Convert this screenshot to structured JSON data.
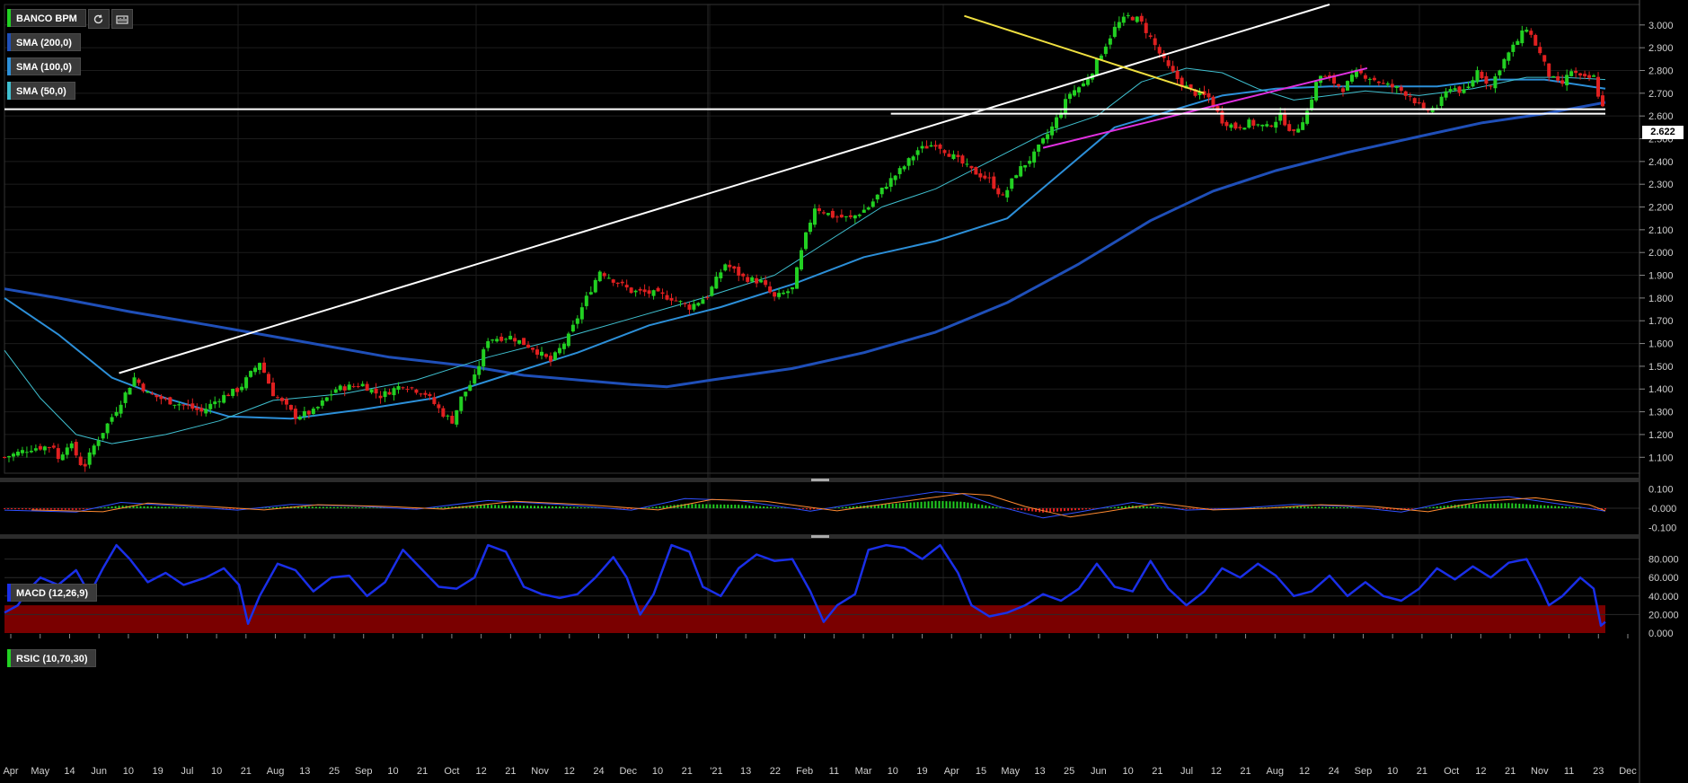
{
  "instrument": "BANCO BPM",
  "colors": {
    "background": "#000000",
    "grid": "#1c1c1c",
    "up_candle": "#22d022",
    "down_candle": "#e02020",
    "sma200": "#1f4fb8",
    "sma100": "#2c8fd8",
    "sma50": "#3fbfcf",
    "trendline_white": "#ffffff",
    "trendline_yellow": "#f0e040",
    "trendline_magenta": "#e030e0",
    "rsi_line": "#1a2fe8",
    "rsi_overbought": "#0c8a0c",
    "rsi_oversold": "#7a0000",
    "macd_line": "#3050ff",
    "signal_line": "#ff8a30"
  },
  "toolbar": {
    "refresh_icon": "refresh-icon",
    "settings_icon": "chart-settings-icon"
  },
  "indicators": [
    {
      "label": "SMA (200,0)",
      "color": "#1f4fb8"
    },
    {
      "label": "SMA (100,0)",
      "color": "#2c8fd8"
    },
    {
      "label": "SMA (50,0)",
      "color": "#3fbfcf"
    }
  ],
  "macd": {
    "label": "MACD (12,26,9)",
    "yticks": [
      "0.100",
      "-0.000",
      "-0.100"
    ]
  },
  "rsi": {
    "label": "RSIC (10,70,30)",
    "yticks": [
      "80.000",
      "60.000",
      "40.000",
      "20.000",
      "0.000"
    ],
    "overbought": 70,
    "oversold": 30
  },
  "chart_data": {
    "type": "candlestick",
    "price_last": "2.622",
    "ylim": [
      1.03,
      3.09
    ],
    "yticks": [
      "3.000",
      "2.900",
      "2.800",
      "2.700",
      "2.600",
      "2.500",
      "2.400",
      "2.300",
      "2.200",
      "2.100",
      "2.000",
      "1.900",
      "1.800",
      "1.700",
      "1.600",
      "1.500",
      "1.400",
      "1.300",
      "1.200",
      "1.100"
    ],
    "xticks": [
      "Apr",
      "May",
      "14",
      "Jun",
      "10",
      "19",
      "Jul",
      "10",
      "21",
      "Aug",
      "13",
      "25",
      "Sep",
      "10",
      "21",
      "Oct",
      "12",
      "21",
      "Nov",
      "12",
      "24",
      "Dec",
      "10",
      "21",
      "'21",
      "13",
      "22",
      "Feb",
      "11",
      "Mar",
      "10",
      "19",
      "Apr",
      "15",
      "May",
      "13",
      "25",
      "Jun",
      "10",
      "21",
      "Jul",
      "12",
      "21",
      "Aug",
      "12",
      "24",
      "Sep",
      "10",
      "21",
      "Oct",
      "12",
      "21",
      "Nov",
      "11",
      "23",
      "Dec"
    ],
    "close_path": [
      [
        0,
        1.1
      ],
      [
        30,
        1.14
      ],
      [
        55,
        1.15
      ],
      [
        60,
        1.09
      ],
      [
        72,
        1.17
      ],
      [
        88,
        1.05
      ],
      [
        100,
        1.15
      ],
      [
        125,
        1.31
      ],
      [
        145,
        1.45
      ],
      [
        160,
        1.38
      ],
      [
        180,
        1.35
      ],
      [
        200,
        1.33
      ],
      [
        220,
        1.3
      ],
      [
        240,
        1.36
      ],
      [
        262,
        1.4
      ],
      [
        285,
        1.52
      ],
      [
        300,
        1.38
      ],
      [
        325,
        1.28
      ],
      [
        345,
        1.3
      ],
      [
        370,
        1.4
      ],
      [
        400,
        1.42
      ],
      [
        420,
        1.37
      ],
      [
        445,
        1.42
      ],
      [
        470,
        1.38
      ],
      [
        490,
        1.29
      ],
      [
        500,
        1.26
      ],
      [
        510,
        1.36
      ],
      [
        525,
        1.45
      ],
      [
        540,
        1.62
      ],
      [
        565,
        1.63
      ],
      [
        590,
        1.58
      ],
      [
        610,
        1.52
      ],
      [
        630,
        1.63
      ],
      [
        650,
        1.8
      ],
      [
        665,
        1.92
      ],
      [
        680,
        1.88
      ],
      [
        700,
        1.83
      ],
      [
        725,
        1.82
      ],
      [
        745,
        1.8
      ],
      [
        765,
        1.76
      ],
      [
        785,
        1.81
      ],
      [
        805,
        1.95
      ],
      [
        825,
        1.89
      ],
      [
        845,
        1.87
      ],
      [
        860,
        1.8
      ],
      [
        880,
        1.84
      ],
      [
        893,
        2.05
      ],
      [
        905,
        2.2
      ],
      [
        925,
        2.16
      ],
      [
        945,
        2.15
      ],
      [
        965,
        2.2
      ],
      [
        985,
        2.3
      ],
      [
        1005,
        2.38
      ],
      [
        1020,
        2.45
      ],
      [
        1040,
        2.48
      ],
      [
        1060,
        2.42
      ],
      [
        1080,
        2.36
      ],
      [
        1100,
        2.32
      ],
      [
        1115,
        2.24
      ],
      [
        1130,
        2.35
      ],
      [
        1150,
        2.43
      ],
      [
        1170,
        2.55
      ],
      [
        1190,
        2.7
      ],
      [
        1205,
        2.74
      ],
      [
        1215,
        2.8
      ],
      [
        1228,
        2.9
      ],
      [
        1242,
        3.0
      ],
      [
        1256,
        3.04
      ],
      [
        1268,
        3.02
      ],
      [
        1282,
        2.93
      ],
      [
        1298,
        2.82
      ],
      [
        1315,
        2.74
      ],
      [
        1330,
        2.7
      ],
      [
        1345,
        2.68
      ],
      [
        1360,
        2.58
      ],
      [
        1375,
        2.55
      ],
      [
        1390,
        2.57
      ],
      [
        1410,
        2.55
      ],
      [
        1425,
        2.6
      ],
      [
        1440,
        2.52
      ],
      [
        1455,
        2.62
      ],
      [
        1468,
        2.78
      ],
      [
        1480,
        2.76
      ],
      [
        1495,
        2.72
      ],
      [
        1510,
        2.79
      ],
      [
        1525,
        2.77
      ],
      [
        1540,
        2.74
      ],
      [
        1556,
        2.72
      ],
      [
        1570,
        2.69
      ],
      [
        1585,
        2.62
      ],
      [
        1600,
        2.64
      ],
      [
        1615,
        2.73
      ],
      [
        1632,
        2.7
      ],
      [
        1645,
        2.8
      ],
      [
        1660,
        2.73
      ],
      [
        1672,
        2.83
      ],
      [
        1688,
        2.92
      ],
      [
        1700,
        2.99
      ],
      [
        1712,
        2.9
      ],
      [
        1725,
        2.78
      ],
      [
        1738,
        2.73
      ],
      [
        1750,
        2.8
      ],
      [
        1762,
        2.76
      ],
      [
        1775,
        2.77
      ],
      [
        1783,
        2.65
      ],
      [
        1788,
        2.62
      ]
    ],
    "series": [
      {
        "name": "SMA (200,0)",
        "values": [
          [
            0,
            1.84
          ],
          [
            60,
            1.8
          ],
          [
            140,
            1.74
          ],
          [
            230,
            1.68
          ],
          [
            330,
            1.61
          ],
          [
            430,
            1.54
          ],
          [
            520,
            1.5
          ],
          [
            580,
            1.46
          ],
          [
            640,
            1.44
          ],
          [
            700,
            1.42
          ],
          [
            740,
            1.41
          ],
          [
            790,
            1.44
          ],
          [
            880,
            1.49
          ],
          [
            960,
            1.56
          ],
          [
            1040,
            1.65
          ],
          [
            1120,
            1.78
          ],
          [
            1200,
            1.95
          ],
          [
            1280,
            2.14
          ],
          [
            1350,
            2.27
          ],
          [
            1420,
            2.36
          ],
          [
            1500,
            2.44
          ],
          [
            1580,
            2.51
          ],
          [
            1650,
            2.57
          ],
          [
            1720,
            2.61
          ],
          [
            1788,
            2.66
          ]
        ]
      },
      {
        "name": "SMA (100,0)",
        "values": [
          [
            0,
            1.8
          ],
          [
            60,
            1.64
          ],
          [
            120,
            1.45
          ],
          [
            180,
            1.36
          ],
          [
            250,
            1.28
          ],
          [
            320,
            1.27
          ],
          [
            400,
            1.31
          ],
          [
            480,
            1.36
          ],
          [
            560,
            1.46
          ],
          [
            640,
            1.56
          ],
          [
            720,
            1.68
          ],
          [
            800,
            1.76
          ],
          [
            880,
            1.86
          ],
          [
            960,
            1.98
          ],
          [
            1040,
            2.05
          ],
          [
            1120,
            2.15
          ],
          [
            1180,
            2.35
          ],
          [
            1240,
            2.55
          ],
          [
            1300,
            2.62
          ],
          [
            1360,
            2.69
          ],
          [
            1420,
            2.72
          ],
          [
            1480,
            2.73
          ],
          [
            1540,
            2.73
          ],
          [
            1600,
            2.73
          ],
          [
            1660,
            2.76
          ],
          [
            1720,
            2.76
          ],
          [
            1788,
            2.72
          ]
        ]
      },
      {
        "name": "SMA (50,0)",
        "values": [
          [
            0,
            1.57
          ],
          [
            40,
            1.36
          ],
          [
            80,
            1.2
          ],
          [
            120,
            1.16
          ],
          [
            180,
            1.2
          ],
          [
            240,
            1.26
          ],
          [
            300,
            1.35
          ],
          [
            380,
            1.38
          ],
          [
            460,
            1.44
          ],
          [
            540,
            1.54
          ],
          [
            620,
            1.62
          ],
          [
            700,
            1.71
          ],
          [
            780,
            1.8
          ],
          [
            860,
            1.9
          ],
          [
            920,
            2.05
          ],
          [
            980,
            2.2
          ],
          [
            1040,
            2.28
          ],
          [
            1100,
            2.4
          ],
          [
            1160,
            2.52
          ],
          [
            1220,
            2.6
          ],
          [
            1270,
            2.75
          ],
          [
            1320,
            2.81
          ],
          [
            1360,
            2.79
          ],
          [
            1400,
            2.72
          ],
          [
            1440,
            2.67
          ],
          [
            1480,
            2.69
          ],
          [
            1520,
            2.71
          ],
          [
            1580,
            2.69
          ],
          [
            1640,
            2.72
          ],
          [
            1700,
            2.77
          ],
          [
            1740,
            2.77
          ],
          [
            1788,
            2.76
          ]
        ]
      }
    ],
    "trendlines": [
      {
        "color": "#ffffff",
        "points": [
          [
            128,
            1.47
          ],
          [
            1480,
            3.09
          ]
        ]
      },
      {
        "color": "#f0e040",
        "points": [
          [
            1072,
            3.04
          ],
          [
            1340,
            2.7
          ]
        ]
      },
      {
        "color": "#e030e0",
        "points": [
          [
            1160,
            2.46
          ],
          [
            1522,
            2.81
          ]
        ]
      },
      {
        "color": "#ffffff",
        "points": [
          [
            0,
            2.63
          ],
          [
            1788,
            2.63
          ]
        ]
      },
      {
        "color": "#ffffff",
        "points": [
          [
            990,
            2.61
          ],
          [
            1788,
            2.61
          ]
        ]
      }
    ],
    "rsi_values": [
      [
        0,
        22
      ],
      [
        15,
        30
      ],
      [
        25,
        45
      ],
      [
        40,
        60
      ],
      [
        60,
        52
      ],
      [
        80,
        68
      ],
      [
        95,
        42
      ],
      [
        110,
        70
      ],
      [
        125,
        95
      ],
      [
        140,
        80
      ],
      [
        160,
        55
      ],
      [
        180,
        65
      ],
      [
        200,
        52
      ],
      [
        225,
        60
      ],
      [
        245,
        70
      ],
      [
        262,
        52
      ],
      [
        272,
        10
      ],
      [
        285,
        40
      ],
      [
        305,
        75
      ],
      [
        325,
        68
      ],
      [
        345,
        45
      ],
      [
        365,
        60
      ],
      [
        385,
        62
      ],
      [
        405,
        40
      ],
      [
        425,
        55
      ],
      [
        445,
        90
      ],
      [
        465,
        70
      ],
      [
        485,
        50
      ],
      [
        505,
        48
      ],
      [
        525,
        60
      ],
      [
        540,
        95
      ],
      [
        560,
        88
      ],
      [
        580,
        50
      ],
      [
        600,
        42
      ],
      [
        620,
        38
      ],
      [
        640,
        42
      ],
      [
        660,
        60
      ],
      [
        680,
        82
      ],
      [
        695,
        60
      ],
      [
        710,
        20
      ],
      [
        725,
        42
      ],
      [
        745,
        95
      ],
      [
        765,
        88
      ],
      [
        780,
        50
      ],
      [
        800,
        40
      ],
      [
        820,
        70
      ],
      [
        840,
        85
      ],
      [
        860,
        78
      ],
      [
        880,
        80
      ],
      [
        900,
        45
      ],
      [
        915,
        12
      ],
      [
        930,
        30
      ],
      [
        950,
        42
      ],
      [
        965,
        90
      ],
      [
        985,
        95
      ],
      [
        1005,
        92
      ],
      [
        1025,
        80
      ],
      [
        1045,
        95
      ],
      [
        1065,
        65
      ],
      [
        1080,
        30
      ],
      [
        1100,
        18
      ],
      [
        1120,
        22
      ],
      [
        1140,
        30
      ],
      [
        1160,
        42
      ],
      [
        1180,
        35
      ],
      [
        1200,
        48
      ],
      [
        1220,
        75
      ],
      [
        1240,
        50
      ],
      [
        1260,
        45
      ],
      [
        1280,
        78
      ],
      [
        1300,
        48
      ],
      [
        1320,
        30
      ],
      [
        1340,
        45
      ],
      [
        1360,
        70
      ],
      [
        1380,
        60
      ],
      [
        1400,
        75
      ],
      [
        1420,
        62
      ],
      [
        1440,
        40
      ],
      [
        1460,
        45
      ],
      [
        1480,
        62
      ],
      [
        1500,
        40
      ],
      [
        1520,
        55
      ],
      [
        1540,
        40
      ],
      [
        1560,
        35
      ],
      [
        1580,
        48
      ],
      [
        1600,
        70
      ],
      [
        1620,
        58
      ],
      [
        1640,
        72
      ],
      [
        1660,
        60
      ],
      [
        1680,
        76
      ],
      [
        1700,
        80
      ],
      [
        1715,
        52
      ],
      [
        1725,
        30
      ],
      [
        1740,
        40
      ],
      [
        1760,
        60
      ],
      [
        1775,
        48
      ],
      [
        1783,
        8
      ],
      [
        1788,
        12
      ]
    ],
    "macd_values": [
      [
        0,
        -0.01
      ],
      [
        80,
        -0.02
      ],
      [
        130,
        0.03
      ],
      [
        200,
        0.01
      ],
      [
        260,
        -0.01
      ],
      [
        320,
        0.02
      ],
      [
        400,
        0.01
      ],
      [
        460,
        -0.005
      ],
      [
        540,
        0.04
      ],
      [
        620,
        0.02
      ],
      [
        700,
        -0.01
      ],
      [
        760,
        0.05
      ],
      [
        820,
        0.04
      ],
      [
        900,
        -0.015
      ],
      [
        960,
        0.03
      ],
      [
        1040,
        0.085
      ],
      [
        1070,
        0.075
      ],
      [
        1110,
        0.01
      ],
      [
        1160,
        -0.05
      ],
      [
        1200,
        -0.02
      ],
      [
        1260,
        0.03
      ],
      [
        1320,
        -0.01
      ],
      [
        1380,
        0.0
      ],
      [
        1440,
        0.02
      ],
      [
        1500,
        0.01
      ],
      [
        1560,
        -0.02
      ],
      [
        1620,
        0.04
      ],
      [
        1680,
        0.06
      ],
      [
        1740,
        0.02
      ],
      [
        1788,
        -0.015
      ]
    ]
  }
}
